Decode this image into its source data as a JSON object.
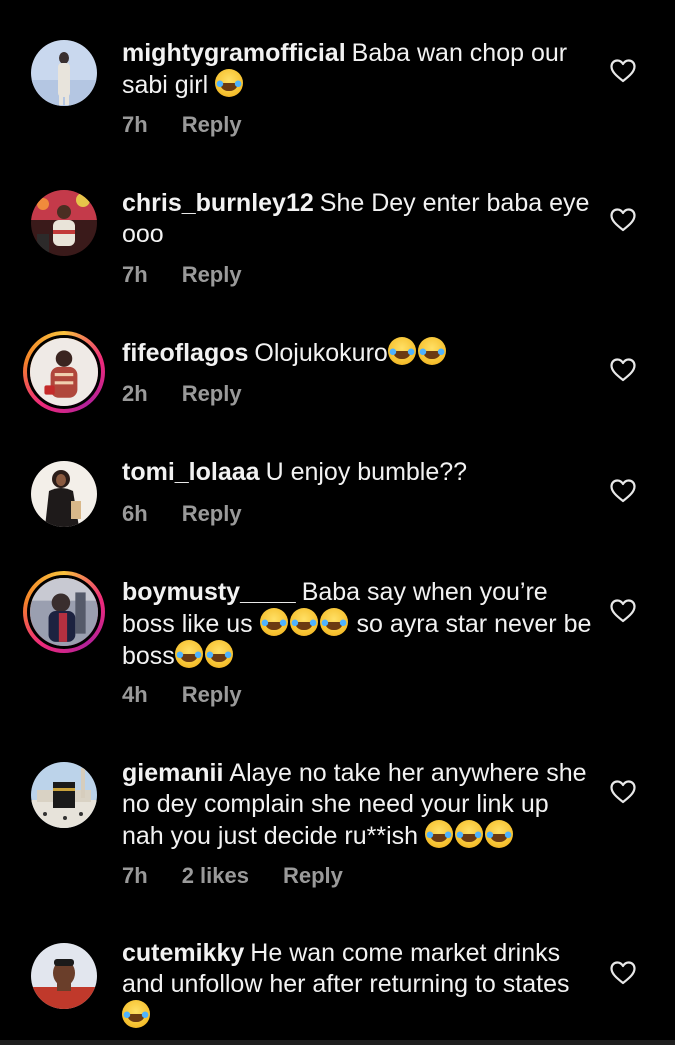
{
  "comments": [
    {
      "username": "mightygramofficial",
      "text": "Baba wan chop our sabi girl",
      "emoji_count": 1,
      "time": "7h",
      "likes": "",
      "reply": "Reply"
    },
    {
      "username": "chris_burnley12",
      "text": "She Dey enter baba eye ooo",
      "emoji_count": 0,
      "time": "7h",
      "likes": "",
      "reply": "Reply"
    },
    {
      "username": "fifeoflagos",
      "text": "Olojukokuro",
      "emoji_count": 2,
      "time": "2h",
      "likes": "",
      "reply": "Reply"
    },
    {
      "username": "tomi_lolaaa",
      "text": "U enjoy bumble??",
      "emoji_count": 0,
      "time": "6h",
      "likes": "",
      "reply": "Reply"
    },
    {
      "username": "boymusty____",
      "text_a": "Baba say when you’re boss like us",
      "text_b": "so ayra star never be boss",
      "time": "4h",
      "likes": "",
      "reply": "Reply"
    },
    {
      "username": "giemanii",
      "text": "Alaye no take her anywhere she no dey complain she need your link up nah you just decide ru**ish",
      "emoji_count": 3,
      "time": "7h",
      "likes": "2 likes",
      "reply": "Reply"
    },
    {
      "username": "cutemikky",
      "text": "He wan come market drinks and unfollow her after returning to states",
      "emoji_count": 1,
      "time": "",
      "likes": "",
      "reply": ""
    }
  ],
  "icons": {
    "like": "heart-outline-icon",
    "emoji": "face-with-tears-of-joy"
  },
  "colors": {
    "background": "#000000",
    "text": "#f2f2f2",
    "meta": "#9a9a9a",
    "story_ring": [
      "#f9c23c",
      "#ee2a7b",
      "#b3219a"
    ]
  }
}
